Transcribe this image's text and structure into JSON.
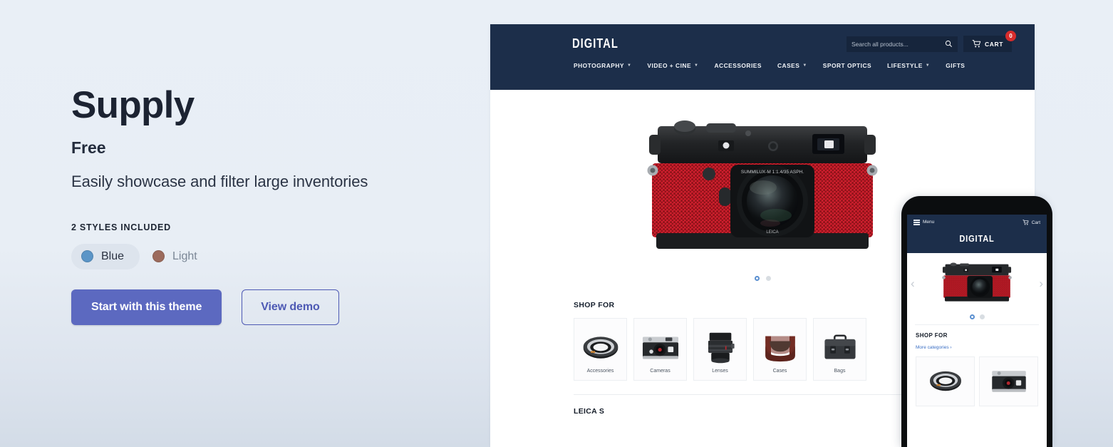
{
  "theme": {
    "title": "Supply",
    "price": "Free",
    "tagline": "Easily showcase and filter large inventories",
    "styles_label": "2 STYLES INCLUDED",
    "styles": [
      {
        "name": "Blue",
        "color": "#5b95c7",
        "selected": true
      },
      {
        "name": "Light",
        "color": "#9c6b5d",
        "selected": false
      }
    ],
    "primary_cta": "Start with this theme",
    "secondary_cta": "View demo",
    "primary_color": "#5c69c0",
    "secondary_color": "#4d59b4",
    "background_color": "#e8eef5"
  },
  "preview": {
    "store": {
      "logo": "DIGITAL",
      "header_color": "#1c2e4a",
      "search": {
        "placeholder": "Search all products...",
        "value": "",
        "icon": "search-icon"
      },
      "cart": {
        "label": "CART",
        "count": "0",
        "badge_color": "#d82c2c",
        "icon": "cart-icon"
      },
      "nav": [
        {
          "label": "PHOTOGRAPHY",
          "has_dropdown": true
        },
        {
          "label": "VIDEO + CINE",
          "has_dropdown": true
        },
        {
          "label": "ACCESSORIES",
          "has_dropdown": false
        },
        {
          "label": "CASES",
          "has_dropdown": true
        },
        {
          "label": "SPORT OPTICS",
          "has_dropdown": false
        },
        {
          "label": "LIFESTYLE",
          "has_dropdown": true
        },
        {
          "label": "GIFTS",
          "has_dropdown": false
        }
      ],
      "hero": {
        "product": "Leica M rangefinder camera with red textured body",
        "carousel_slides": 2,
        "active_slide": 1
      },
      "shop_for": {
        "title": "SHOP FOR",
        "categories": [
          {
            "name": "Accessories",
            "icon": "lens-adapter-ring"
          },
          {
            "name": "Cameras",
            "icon": "silver-rangefinder-camera"
          },
          {
            "name": "Lenses",
            "icon": "black-camera-lens"
          },
          {
            "name": "Cases",
            "icon": "brown-leather-case"
          },
          {
            "name": "Bags",
            "icon": "black-camera-bag"
          }
        ]
      },
      "featured_section": {
        "title": "LEICA S"
      }
    },
    "mobile": {
      "menu_label": "Menu",
      "cart_label": "Cart",
      "logo": "DIGITAL",
      "shop_for_title": "SHOP FOR",
      "more_categories": "More categories ›",
      "carousel_slides": 2,
      "active_slide": 1,
      "prev_arrow": "‹",
      "next_arrow": "›",
      "cards": [
        {
          "name": "Accessories",
          "icon": "lens-adapter-ring"
        },
        {
          "name": "Cameras",
          "icon": "silver-rangefinder-camera"
        }
      ]
    }
  }
}
